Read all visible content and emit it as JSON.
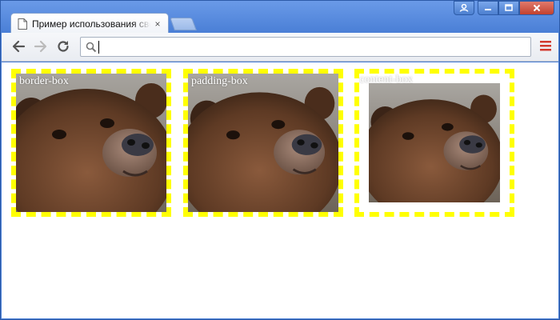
{
  "browser": {
    "tab_title": "Пример использования свойства background-origin",
    "tab_close": "×",
    "address_value": "",
    "icons": {
      "page": "document-icon",
      "back": "back-arrow-icon",
      "forward": "forward-arrow-icon",
      "reload": "reload-icon",
      "search": "magnifier-icon",
      "menu": "hamburger-menu-icon",
      "user": "user-icon",
      "minimize": "minimize-icon",
      "maximize": "maximize-icon",
      "close": "close-icon"
    },
    "colors": {
      "frame": "#4a7fd6",
      "menu_icon": "#d23a2f",
      "close_button": "#c2412f"
    }
  },
  "demos": [
    {
      "label": "border-box",
      "origin": "border-box"
    },
    {
      "label": "padding-box",
      "origin": "padding-box"
    },
    {
      "label": "content-box",
      "origin": "content-box"
    }
  ],
  "colors": {
    "dashed_border": "#ffff00",
    "label_text": "#ffffff"
  }
}
